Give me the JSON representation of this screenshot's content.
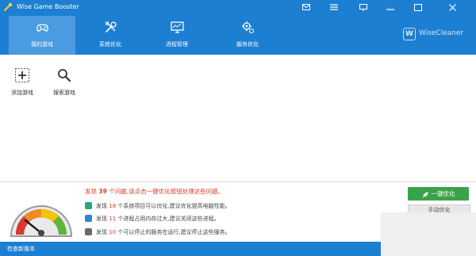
{
  "window": {
    "title": "Wise Game Booster",
    "controls": [
      "mail-icon",
      "menu-icon",
      "feedback-icon",
      "minimize-icon",
      "maximize-icon",
      "close-icon"
    ]
  },
  "nav": {
    "tabs": [
      {
        "label": "我的游戏",
        "icon": "gamepad-icon",
        "active": true
      },
      {
        "label": "系统优化",
        "icon": "tools-icon",
        "active": false
      },
      {
        "label": "进程管理",
        "icon": "monitor-icon",
        "active": false
      },
      {
        "label": "服务优化",
        "icon": "service-gear-icon",
        "active": false
      }
    ]
  },
  "brand": {
    "logo_letter": "W",
    "name": "WiseCleaner"
  },
  "toolbar": {
    "add_label": "添加游戏",
    "search_label": "搜索游戏"
  },
  "summary": {
    "prefix": "发现 ",
    "count": "39",
    "suffix": " 个问题,请点击一键优化按钮处理这些问题。"
  },
  "items": [
    {
      "pre": "发现 ",
      "num": "18",
      "post": " 个系统项目可以优化,建议优化提高电脑性能。",
      "icon": "system-icon",
      "color": "#2aa47c"
    },
    {
      "pre": "发现 ",
      "num": "11",
      "post": " 个进程占用内存过大,建议关闭这些进程。",
      "icon": "process-icon",
      "color": "#2a86d2"
    },
    {
      "pre": "发现 ",
      "num": "10",
      "post": " 个可以停止的服务在运行,建议停止这些服务。",
      "icon": "service-icon",
      "color": "#6a6a6a"
    }
  ],
  "actions": {
    "optimize_label": "一键优化",
    "manual_label": "手动优化"
  },
  "status": {
    "text": "检查新版本"
  },
  "colors": {
    "header": "#1d7fd2",
    "active_tab": "#4b9be0",
    "accent_red": "#e03a2a",
    "optimize_green": "#3aa34a"
  }
}
